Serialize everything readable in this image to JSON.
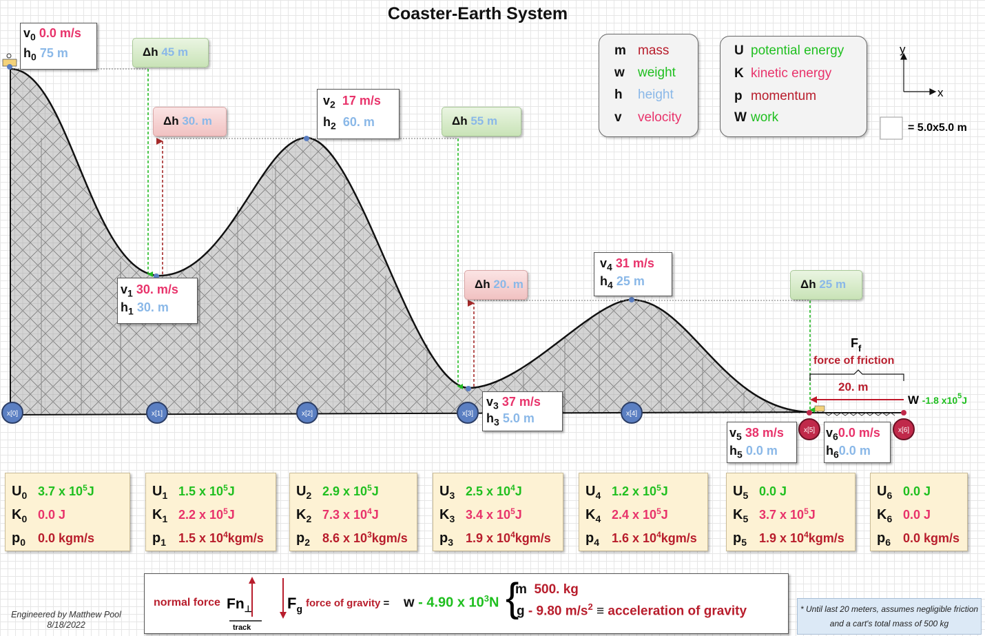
{
  "title": "Coaster-Earth System",
  "legend_vars": [
    {
      "sym": "m",
      "name": "mass",
      "color": "#c0182a"
    },
    {
      "sym": "w",
      "name": "weight",
      "color": "#1fbf1f"
    },
    {
      "sym": "h",
      "name": "height",
      "color": "#8ab8e8"
    },
    {
      "sym": "v",
      "name": "velocity",
      "color": "#e8336b"
    }
  ],
  "legend_energy": [
    {
      "sym": "U",
      "name": "potential energy",
      "color": "#1fbf1f"
    },
    {
      "sym": "K",
      "name": "kinetic energy",
      "color": "#e8336b"
    },
    {
      "sym": "p",
      "name": "momentum",
      "color": "#b81d2c"
    },
    {
      "sym": "W",
      "name": "work",
      "color": "#1fbf1f"
    }
  ],
  "axes": {
    "y": "y",
    "x": "x"
  },
  "grid_scale": "= 5.0x5.0 m",
  "points": [
    {
      "v_sym": "v",
      "h_sym": "h",
      "sub": "0",
      "v": "0.0 m/s",
      "h": "75 m"
    },
    {
      "v_sym": "v",
      "h_sym": "h",
      "sub": "1",
      "v": "30. m/s",
      "h": "30. m"
    },
    {
      "v_sym": "v",
      "h_sym": "h",
      "sub": "2",
      "v": "17 m/s",
      "h": "60. m"
    },
    {
      "v_sym": "v",
      "h_sym": "h",
      "sub": "3",
      "v": "37 m/s",
      "h": "5.0 m"
    },
    {
      "v_sym": "v",
      "h_sym": "h",
      "sub": "4",
      "v": "31 m/s",
      "h": "25 m"
    },
    {
      "v_sym": "v",
      "h_sym": "h",
      "sub": "5",
      "v": "38 m/s",
      "h": "0.0 m"
    },
    {
      "v_sym": "v",
      "h_sym": "h",
      "sub": "6",
      "v": "0.0 m/s",
      "h": "0.0 m"
    }
  ],
  "dh": [
    {
      "sym": "Δh",
      "value": "45 m"
    },
    {
      "sym": "Δh",
      "value": "30. m"
    },
    {
      "sym": "Δh",
      "value": "55 m"
    },
    {
      "sym": "Δh",
      "value": "20. m"
    },
    {
      "sym": "Δh",
      "value": "25 m"
    }
  ],
  "nodes": [
    "x[0]",
    "x[1]",
    "x[2]",
    "x[3]",
    "x[4]",
    "x[5]",
    "x[6]"
  ],
  "friction": {
    "sym": "F",
    "sub": "f",
    "label": "force of friction",
    "distance": "20.  m",
    "work_sym": "W",
    "work_value": "-1.8 x10",
    "work_exp": "5",
    "work_unit": "J"
  },
  "energy": [
    {
      "sub": "0",
      "U": "3.7 x 10",
      "U_exp": "5",
      "U_unit": "J",
      "K": "0.0 J",
      "K_exp": "",
      "K_unit": "",
      "p": "0.0 kgm/s",
      "p_exp": "",
      "p_unit": ""
    },
    {
      "sub": "1",
      "U": "1.5 x 10",
      "U_exp": "5",
      "U_unit": "J",
      "K": "2.2 x 10",
      "K_exp": "5",
      "K_unit": "J",
      "p": "1.5 x 10",
      "p_exp": "4",
      "p_unit": "kgm/s"
    },
    {
      "sub": "2",
      "U": "2.9 x 10",
      "U_exp": "5",
      "U_unit": "J",
      "K": "7.3 x 10",
      "K_exp": "4",
      "K_unit": "J",
      "p": "8.6 x 10",
      "p_exp": "3",
      "p_unit": "kgm/s"
    },
    {
      "sub": "3",
      "U": "2.5 x 10",
      "U_exp": "4",
      "U_unit": "J",
      "K": "3.4 x 10",
      "K_exp": "5",
      "K_unit": "J",
      "p": "1.9 x 10",
      "p_exp": "4",
      "p_unit": "kgm/s"
    },
    {
      "sub": "4",
      "U": "1.2 x 10",
      "U_exp": "5",
      "U_unit": "J",
      "K": "2.4 x 10",
      "K_exp": "5",
      "K_unit": "J",
      "p": "1.6 x 10",
      "p_exp": "4",
      "p_unit": "kgm/s"
    },
    {
      "sub": "5",
      "U": "0.0 J",
      "U_exp": "",
      "U_unit": "",
      "K": "3.7 x 10",
      "K_exp": "5",
      "K_unit": "J",
      "p": "1.9 x 10",
      "p_exp": "4",
      "p_unit": "kgm/s"
    },
    {
      "sub": "6",
      "U": "0.0 J",
      "U_exp": "",
      "U_unit": "",
      "K": "0.0 J",
      "K_exp": "",
      "K_unit": "",
      "p": "0.0 kgm/s",
      "p_exp": "",
      "p_unit": ""
    }
  ],
  "equation": {
    "normal_label": "normal force",
    "fn_sym": "Fn",
    "fn_sub": "⊥",
    "track_label": "track",
    "fg_sym": "F",
    "fg_sub": "g",
    "fg_label": "force of gravity",
    "eq1": "=",
    "w_sym": "w",
    "w_value": "- 4.90 x 10",
    "w_exp": "3",
    "w_unit": "N",
    "m_sym": "m",
    "m_value": "500. kg",
    "g_sym": "g",
    "g_value": "- 9.80 m/s",
    "g_exp": "2",
    "equiv": "≡",
    "g_label": "acceleration of gravity"
  },
  "note": [
    "* Until last 20 meters, assumes negligible friction",
    "and a cart's total mass of 500 kg"
  ],
  "credit": [
    "Engineered by Matthew Pool",
    "8/18/2022"
  ]
}
